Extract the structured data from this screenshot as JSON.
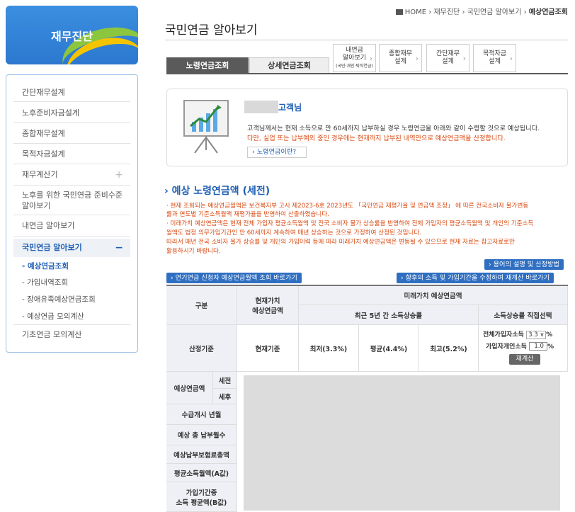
{
  "sidebar": {
    "title": "재무진단",
    "items": [
      "간단재무설계",
      "노후준비자금설계",
      "종합재무설계",
      "목적자금설계",
      "재무계산기",
      "노후를 위한 국민연금 준비수준 알아보기",
      "내연금 알아보기",
      "국민연금 알아보기",
      "기초연금 모의계산"
    ],
    "expand_plus": "+",
    "expand_minus": "−",
    "sub_items": [
      "- 예상연금조회",
      "- 가입내역조회",
      "- 장애유족예상연금조회",
      "- 예상연금 모의계산"
    ]
  },
  "breadcrumb": {
    "home": "HOME",
    "sep": "›",
    "p1": "재무진단",
    "p2": "국민연금 알아보기",
    "current": "예상연금조회"
  },
  "page_title": "국민연금 알아보기",
  "tabs": {
    "t1": "노령연금조회",
    "t2": "상세연금조회"
  },
  "sub_tabs": [
    {
      "l1": "내연금",
      "l2": "알아보기",
      "l3": "(국민·개인·퇴직연금)"
    },
    {
      "l1": "종합재무",
      "l2": "설계"
    },
    {
      "l1": "간단재무",
      "l2": "설계"
    },
    {
      "l1": "목적자금",
      "l2": "설계"
    }
  ],
  "card": {
    "customer": "고객님",
    "msg1": "고객님께서는 현재 소득으로 만 60세까지 납부하실 경우 노령연금을 아래와 같이 수령할 것으로 예상됩니다.",
    "msg2": "다만, 실업 또는 납부예외 중인 경우에는 현재까지 납부된 내역만으로 예상연금액을 산정합니다.",
    "what_btn": "› 노령연금이란?"
  },
  "section_title": "예상 노령연금액 (세전)",
  "notes": [
    "· 현재 조회되는 예상연금월액은 보건복지부 고시 제2023-6호 2023년도 「국민연금 재평가율 및 연금액 조정」 에 따른 전국소비자 물가변동",
    "  률과 연도별 기준소득월액 재평가율을 반영하여 산출하였습니다.",
    "· 미래가치 예상연금액은 현재 전체 가입자 평균소득월액 및 전국 소비자 물가 상승률을 반영하여 전체 가입자의 평균소득월액 및 개인의 기준소득",
    "  월액도 법정 의무가입기간인 만 60세까지 계속하여 매년 상승하는 것으로 가정하여 산정된 것입니다.",
    "  따라서 매년 전국 소비자 물가 상승률 및 개인의 가입이력 등에 따라 미래가치 예상연금액은 변동될 수 있으므로 현재 자료는 참고자료로만",
    "  활용하시기 바랍니다."
  ],
  "buttons": {
    "terms": "› 용어의 설명 및 산정방법",
    "early": "› 연기연금 신청자 예상연금월액 조회 바로가기",
    "recalc_link": "› 향후의 소득 및 가입기간을 수정하여 재계산 바로가기",
    "recalc": "재계산"
  },
  "table": {
    "h_gubun": "구분",
    "h_present": "현재가치\n예상연금액",
    "h_future": "미래가치 예상연금액",
    "h_recent": "최근 5년 간 소득상승률",
    "h_direct": "소득상승률 직접선택",
    "r_basis": "산정기준",
    "present_basis": "현재기준",
    "low": "최저(3.3%)",
    "avg": "평균(4.4%)",
    "high": "최고(5.2%)",
    "all_avg_label": "전체가입자소득",
    "all_avg_value": "3.3",
    "indiv_label": "가입자개인소득",
    "indiv_value": "1.0",
    "pct": "%",
    "dropdown_arrow": "∨",
    "rows": [
      "예상연금액",
      "수급개시 년월",
      "예상 총 납부월수",
      "예상납부보험료총액",
      "평균소득월액(A값)",
      "가입기간중\n소득 평균액(B값)"
    ],
    "sub_pre": "세전",
    "sub_post": "세후"
  }
}
